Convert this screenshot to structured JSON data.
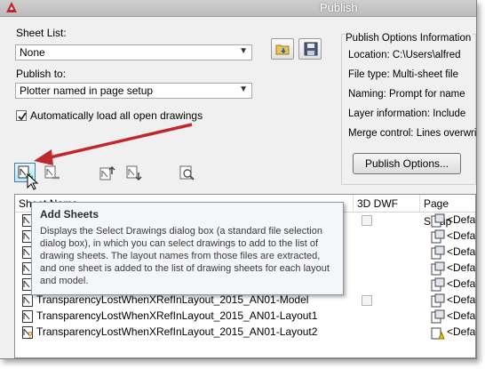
{
  "window": {
    "title": "Publish"
  },
  "sheet_list": {
    "label": "Sheet List:",
    "value": "None"
  },
  "publish_to": {
    "label": "Publish to:",
    "value": "Plotter named in page setup"
  },
  "auto_load": {
    "label": "Automatically load all open drawings",
    "checked": true
  },
  "options_info": {
    "title": "Publish Options Information",
    "location": "Location: C:\\Users\\alfred",
    "file_type": "File type: Multi-sheet file",
    "naming": "Naming: Prompt for name",
    "layer": "Layer information: Include",
    "merge": "Merge control: Lines overwrite",
    "button": "Publish Options..."
  },
  "list": {
    "columns": {
      "sheet_name": "Sheet Name",
      "dwf3d": "3D DWF",
      "page_setup": "Page Setup"
    },
    "page_setup_text": "<Default: None>",
    "rows": [
      {
        "name": "TransparencyLostWhenXRefInLayout_2015_AN01-Model",
        "status": "ok",
        "dwf3d_box": true
      },
      {
        "name": "TransparencyLostWhenXRefInLayout_2015_AN01-Layout1",
        "status": "ok",
        "dwf3d_box": false
      },
      {
        "name": "TransparencyLostWhenXRefInLayout_2015_AN01-Layout2",
        "status": "warning",
        "dwf3d_box": false
      }
    ]
  },
  "tooltip": {
    "title": "Add Sheets",
    "body": "Displays the Select Drawings dialog box (a standard file selection dialog box), in which you can select drawings to add to the list of drawing sheets. The layout names from those files are extracted, and one sheet is added to the list of drawing sheets for each layout and model."
  },
  "colors": {
    "arrow": "#c0282d",
    "titlebar": "#c4c4c4",
    "app_icon": "#c0282d"
  }
}
